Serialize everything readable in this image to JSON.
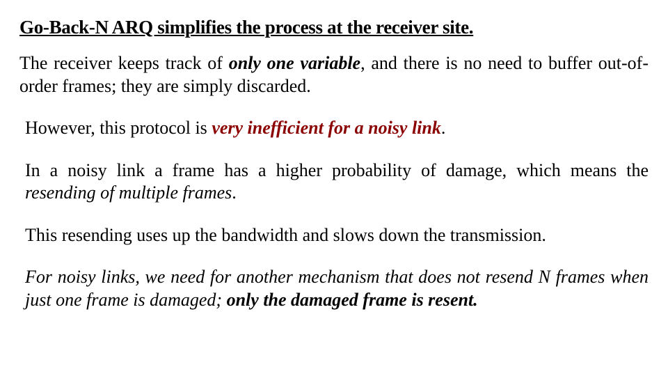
{
  "title": "Go-Back-N ARQ simplifies the process at the receiver site.",
  "p1": {
    "pre": "The receiver keeps track of ",
    "em": "only one variable",
    "post": ", and there is no need to buffer out-of-order frames; they are simply discarded."
  },
  "p2": {
    "pre": "However, this protocol is ",
    "em": "very inefficient for a noisy link",
    "post": "."
  },
  "p3": {
    "pre": "In a noisy link a frame has a higher probability of damage, which means the ",
    "em": "resending of multiple frames",
    "post": "."
  },
  "p4": "This resending uses up the bandwidth and slows down the transmission.",
  "p5": {
    "pre": "For noisy links, we need for another mechanism that does not resend N frames when just one frame is damaged; ",
    "em": "only the damaged frame is resent.",
    "post": ""
  }
}
